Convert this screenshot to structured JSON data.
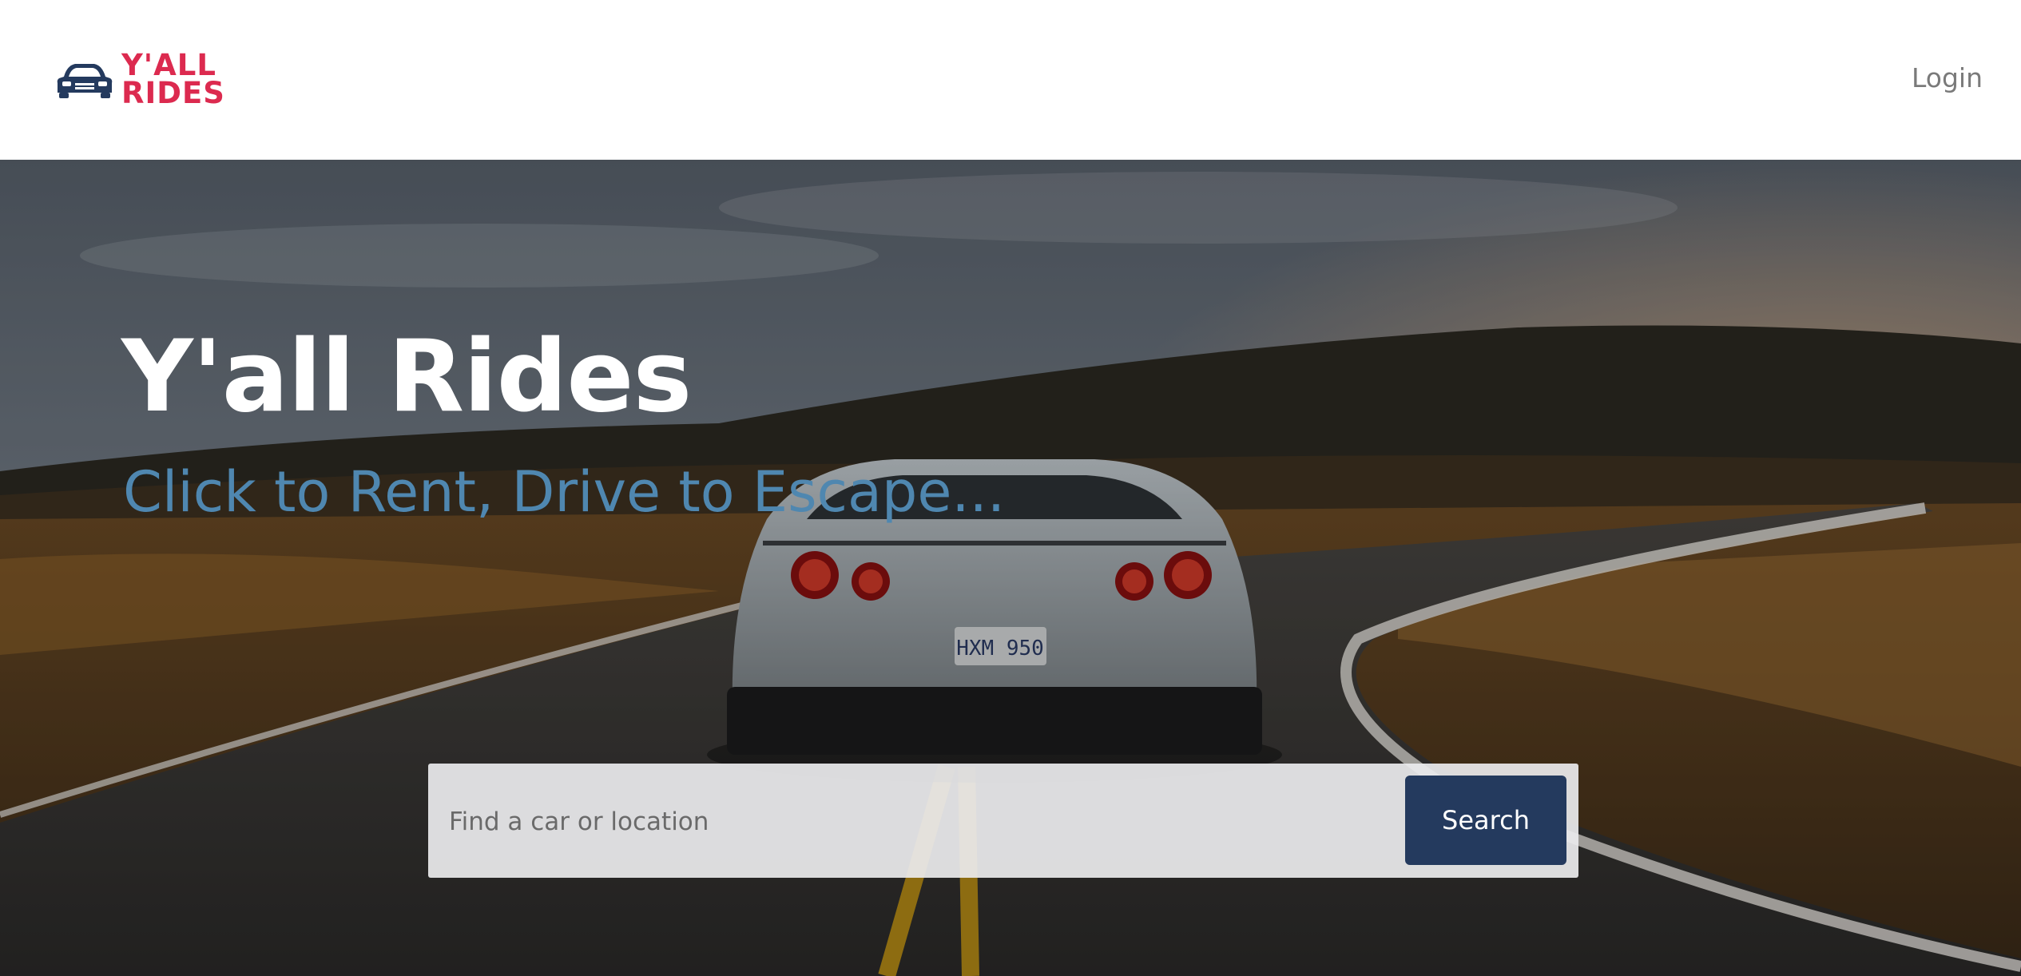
{
  "header": {
    "logo_line1": "Y'ALL",
    "logo_line2": "RIDES",
    "login_label": "Login"
  },
  "hero": {
    "title": "Y'all Rides",
    "subtitle": "Click to Rent, Drive to Escape...",
    "plate_text": "HXM 950"
  },
  "search": {
    "placeholder": "Find a car or location",
    "button_label": "Search"
  },
  "colors": {
    "brand_red": "#dc2a4f",
    "brand_navy": "#243a5e",
    "subtitle_blue": "#4f87b0"
  },
  "icons": {
    "logo": "car-front-icon"
  }
}
